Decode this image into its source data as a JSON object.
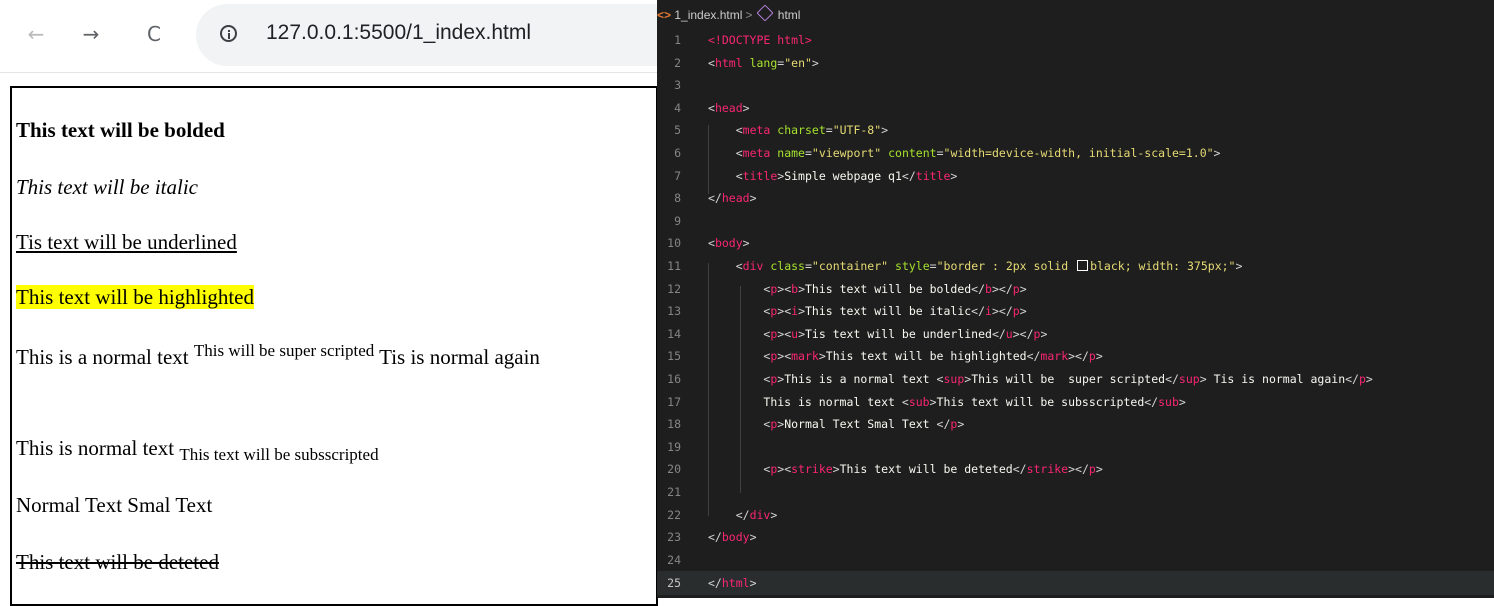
{
  "browser": {
    "nav": {
      "back_icon": "arrow-left-icon",
      "forward_icon": "arrow-right-icon",
      "reload_icon": "reload-icon",
      "back_glyph": "←",
      "forward_glyph": "→",
      "reload_glyph": "C"
    },
    "url": "127.0.0.1:5500/1_index.html",
    "page": {
      "bold_text": "This text will be bolded",
      "italic_text": "This text will be italic",
      "underline_text": "Tis text will be underlined",
      "highlight_text": "This text will be highlighted",
      "sup_before": "This is a normal text ",
      "sup_text": "This will be super scripted",
      "sup_after": " Tis is normal again",
      "sub_before": "This is normal text ",
      "sub_text": "This text will be subsscripted",
      "normal_text": "Normal Text Smal Text",
      "strike_text": "This text will be deteted"
    },
    "colors": {
      "highlight": "#ffff00",
      "border": "#000000"
    }
  },
  "editor": {
    "breadcrumb": {
      "file_glyph": "<>",
      "file": "1_index.html",
      "separator": ">",
      "symbol": "html"
    },
    "current_line": 25,
    "lines": [
      {
        "n": "1"
      },
      {
        "n": "2"
      },
      {
        "n": "3"
      },
      {
        "n": "4"
      },
      {
        "n": "5"
      },
      {
        "n": "6"
      },
      {
        "n": "7"
      },
      {
        "n": "8"
      },
      {
        "n": "9"
      },
      {
        "n": "10"
      },
      {
        "n": "11"
      },
      {
        "n": "12"
      },
      {
        "n": "13"
      },
      {
        "n": "14"
      },
      {
        "n": "15"
      },
      {
        "n": "16"
      },
      {
        "n": "17"
      },
      {
        "n": "18"
      },
      {
        "n": "19"
      },
      {
        "n": "20"
      },
      {
        "n": "21"
      },
      {
        "n": "22"
      },
      {
        "n": "23"
      },
      {
        "n": "24"
      },
      {
        "n": "25"
      }
    ],
    "code": {
      "l1": "<!DOCTYPE html>",
      "l2_tag": "html",
      "l2_attr": "lang",
      "l2_val": "\"en\"",
      "l4_tag": "head",
      "l5_tag": "meta",
      "l5_attr": "charset",
      "l5_val": "\"UTF-8\"",
      "l6_tag": "meta",
      "l6_attr1": "name",
      "l6_val1": "\"viewport\"",
      "l6_attr2": "content",
      "l6_val2": "\"width=device-width, initial-scale=1.0\"",
      "l7_tag": "title",
      "l7_text": "Simple webpage q1",
      "l8_tag": "head",
      "l10_tag": "body",
      "l11_tag": "div",
      "l11_attr1": "class",
      "l11_val1": "\"container\"",
      "l11_attr2": "style",
      "l11_val2a": "\"border : 2px solid ",
      "l11_val2b": "black; width: 375px;\"",
      "l12_text": "This text will be bolded",
      "l13_text": "This text will be italic",
      "l14_text": "Tis text will be underlined",
      "l15_text": "This text will be highlighted",
      "l16_a": "This is a normal text ",
      "l16_b": "This will be  super scripted",
      "l16_c": " Tis is normal again",
      "l17_a": "This is normal text ",
      "l17_b": "This text will be subsscripted",
      "l18_text": "Normal Text Smal Text ",
      "l20_text": "This text will be deteted",
      "l22_tag": "div",
      "l23_tag": "body",
      "l25_tag": "html",
      "tag_p": "p",
      "tag_b": "b",
      "tag_i": "i",
      "tag_u": "u",
      "tag_mark": "mark",
      "tag_sup": "sup",
      "tag_sub": "sub",
      "tag_strike": "strike"
    },
    "colors": {
      "background": "#1e1e1e",
      "tag": "#f92672",
      "attr": "#a6e22e",
      "string": "#e6db74",
      "text": "#f8f8f2"
    }
  }
}
